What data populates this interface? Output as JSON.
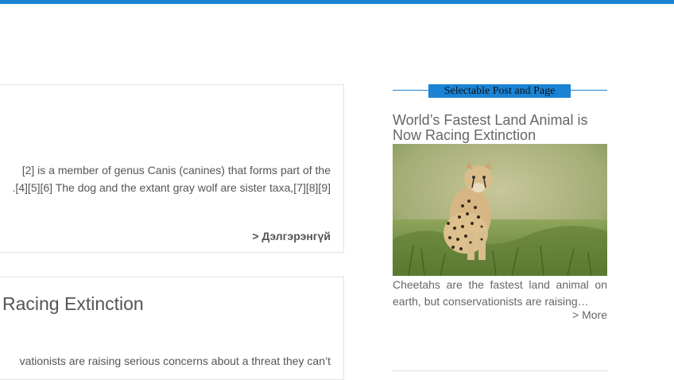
{
  "posts": [
    {
      "excerpt_line1": "[2] is a member of genus Canis (canines) that forms part of the",
      "excerpt_line2": ".[4][5][6] The dog and the extant gray wolf are sister taxa,[7][8][9]",
      "read_more": "> Дэлгэрэнгүй"
    },
    {
      "title": "Racing Extinction",
      "excerpt_line1": "vationists are raising serious concerns about a threat they can’t"
    }
  ],
  "sidebar": {
    "widget_title": "Selectable Post and Page",
    "post_title": "World’s Fastest Land Animal is Now Racing Extinction",
    "excerpt_line1": "Cheetahs are the fastest land animal on",
    "excerpt_line2": "earth, but conservationists are raising…",
    "more_label": "> More",
    "image_subject": "cheetah-photo"
  },
  "colors": {
    "accent": "#1a83d4",
    "text": "#555555",
    "border": "#e3e3e3"
  }
}
